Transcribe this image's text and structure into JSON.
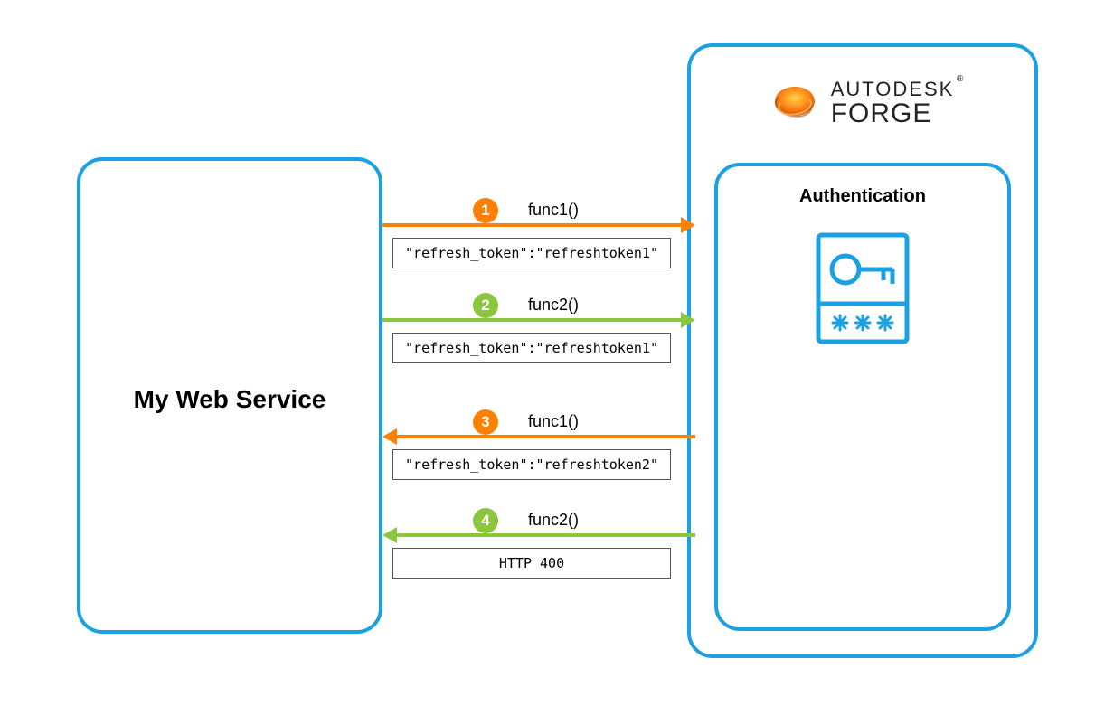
{
  "colors": {
    "border": "#1ba1e2",
    "orange": "#ff7f00",
    "green": "#8cc63f"
  },
  "client": {
    "title": "My Web Service"
  },
  "server": {
    "brand_line1": "AUTODESK",
    "brand_line2": "FORGE",
    "auth_title": "Authentication"
  },
  "steps": [
    {
      "num": "1",
      "label": "func1()",
      "payload": "\"refresh_token\":\"refreshtoken1\""
    },
    {
      "num": "2",
      "label": "func2()",
      "payload": "\"refresh_token\":\"refreshtoken1\""
    },
    {
      "num": "3",
      "label": "func1()",
      "payload": "\"refresh_token\":\"refreshtoken2\""
    },
    {
      "num": "4",
      "label": "func2()",
      "payload": "HTTP 400"
    }
  ]
}
